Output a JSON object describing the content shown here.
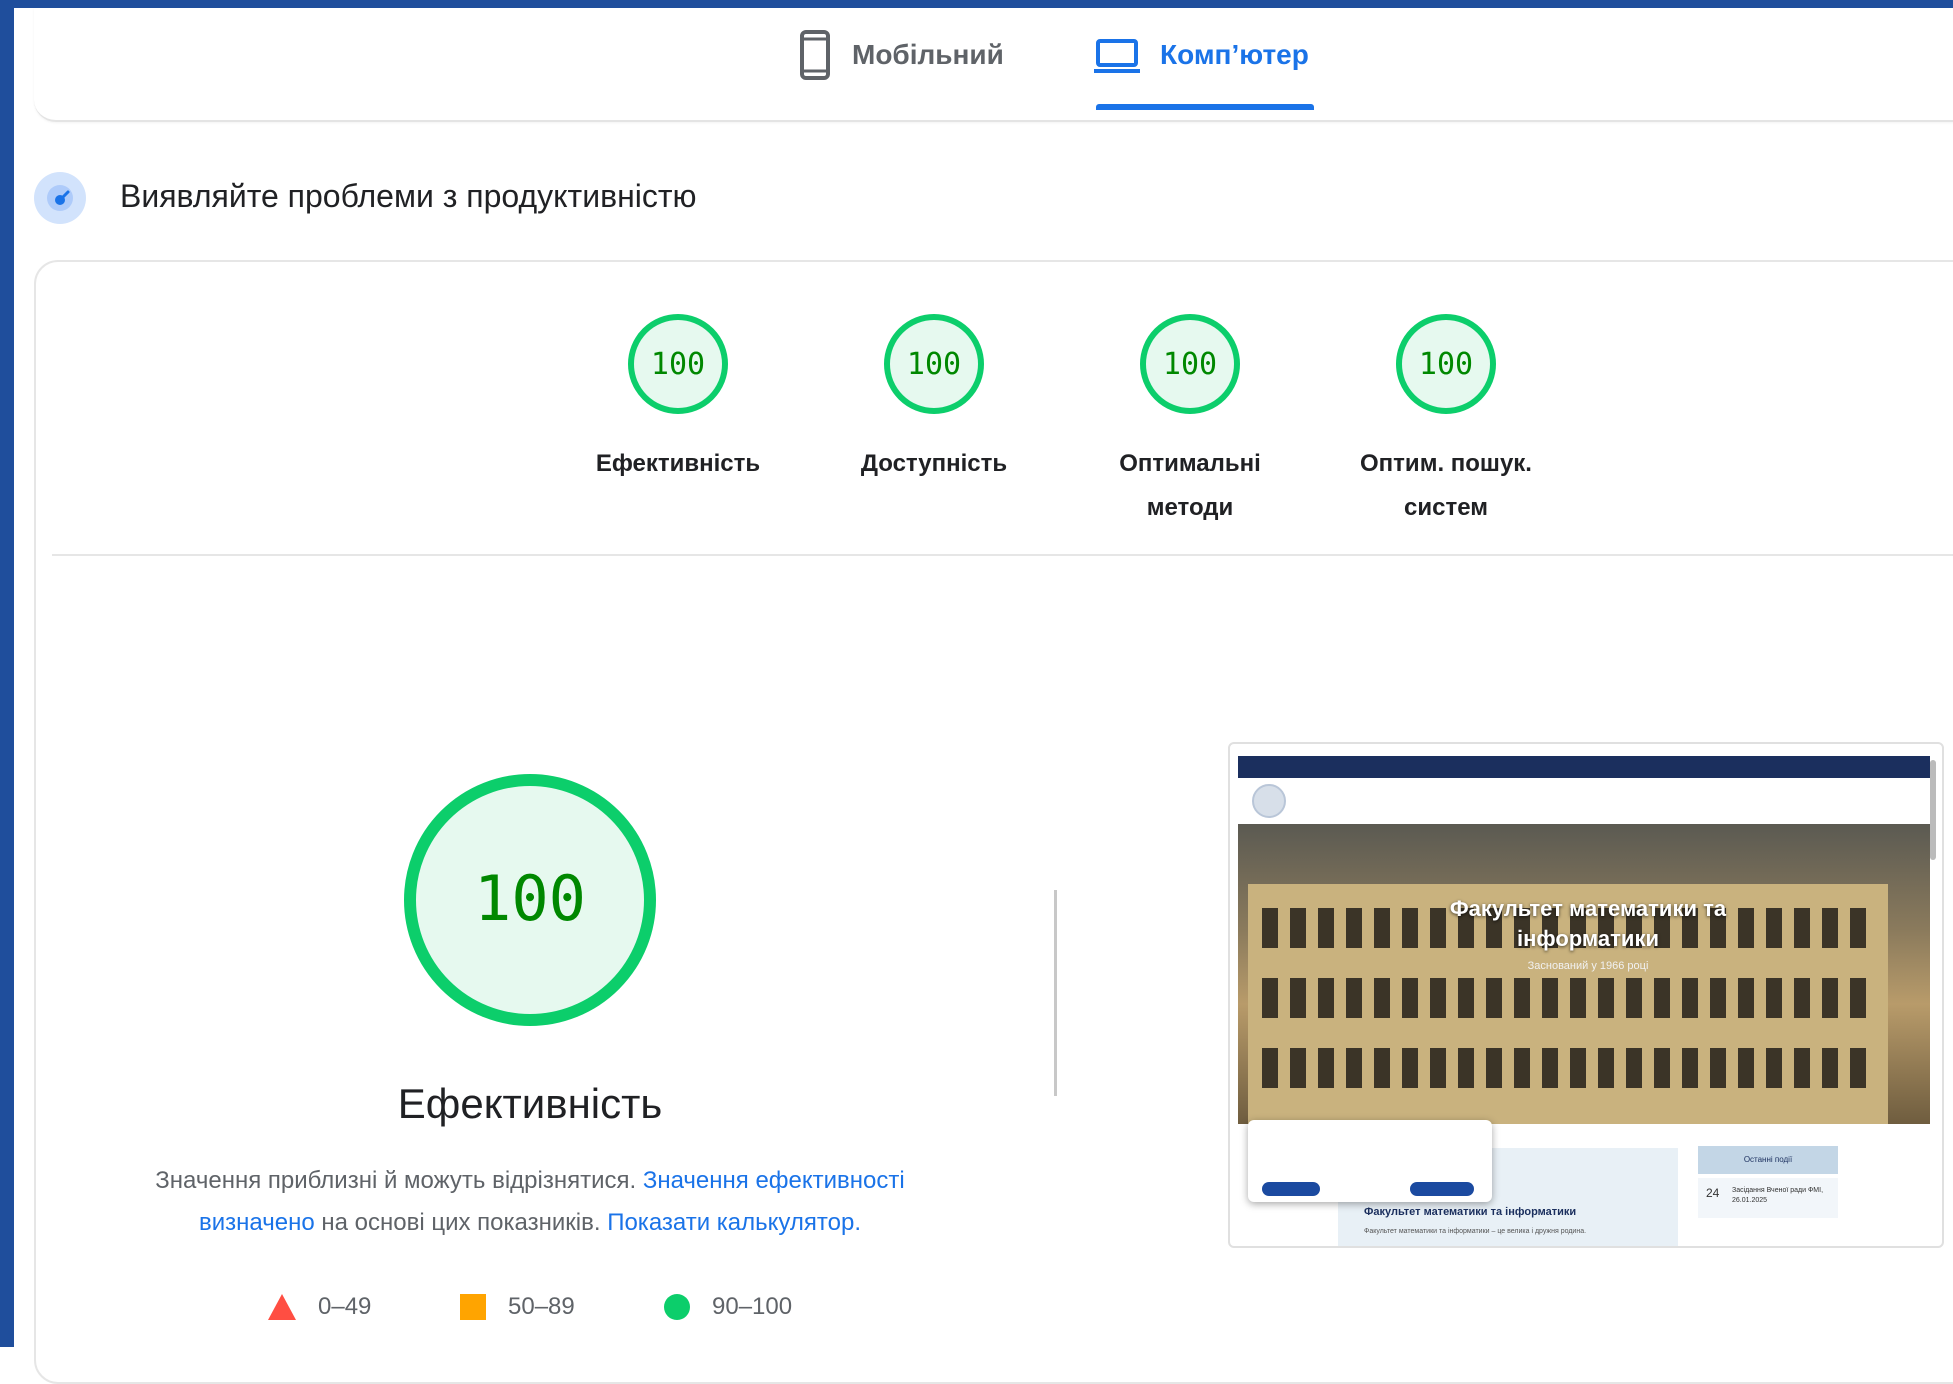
{
  "tabs": {
    "mobile_label": "Мобільний",
    "desktop_label": "Комп’ютер",
    "active": "desktop"
  },
  "section": {
    "title": "Виявляйте проблеми з продуктивністю"
  },
  "scores": [
    {
      "value": "100",
      "label": "Ефективність"
    },
    {
      "value": "100",
      "label": "Доступність"
    },
    {
      "value": "100",
      "label": "Оптимальні методи"
    },
    {
      "value": "100",
      "label": "Оптим. пошук. систем"
    }
  ],
  "performance": {
    "score": "100",
    "title": "Ефективність",
    "desc_part1": "Значення приблизні й можуть відрізнятися. ",
    "desc_link1": "Значення ефективності визначено",
    "desc_part2": " на основі цих показників. ",
    "desc_link2": "Показати калькулятор."
  },
  "legend": {
    "fail": "0–49",
    "average": "50–89",
    "pass": "90–100"
  },
  "colors": {
    "pass": "#0cce6b",
    "pass_text": "#008800",
    "pass_bg": "#e6f9ef",
    "average": "#ffa400",
    "fail": "#ff4e42",
    "link": "#1a73e8",
    "frame": "#1f4e9c"
  },
  "thumbnail": {
    "hero_title": "Факультет математики та інформатики",
    "hero_subtitle": "Заснований у 1966 році",
    "card_title": "Факультет математики та інформатики",
    "card_text": "Факультет математики та інформатики – це велика і дружня родина.",
    "events_header": "Останні події",
    "event_day": "24",
    "event_text": "Засідання Вченої ради ФМІ, 26.01.2025"
  }
}
